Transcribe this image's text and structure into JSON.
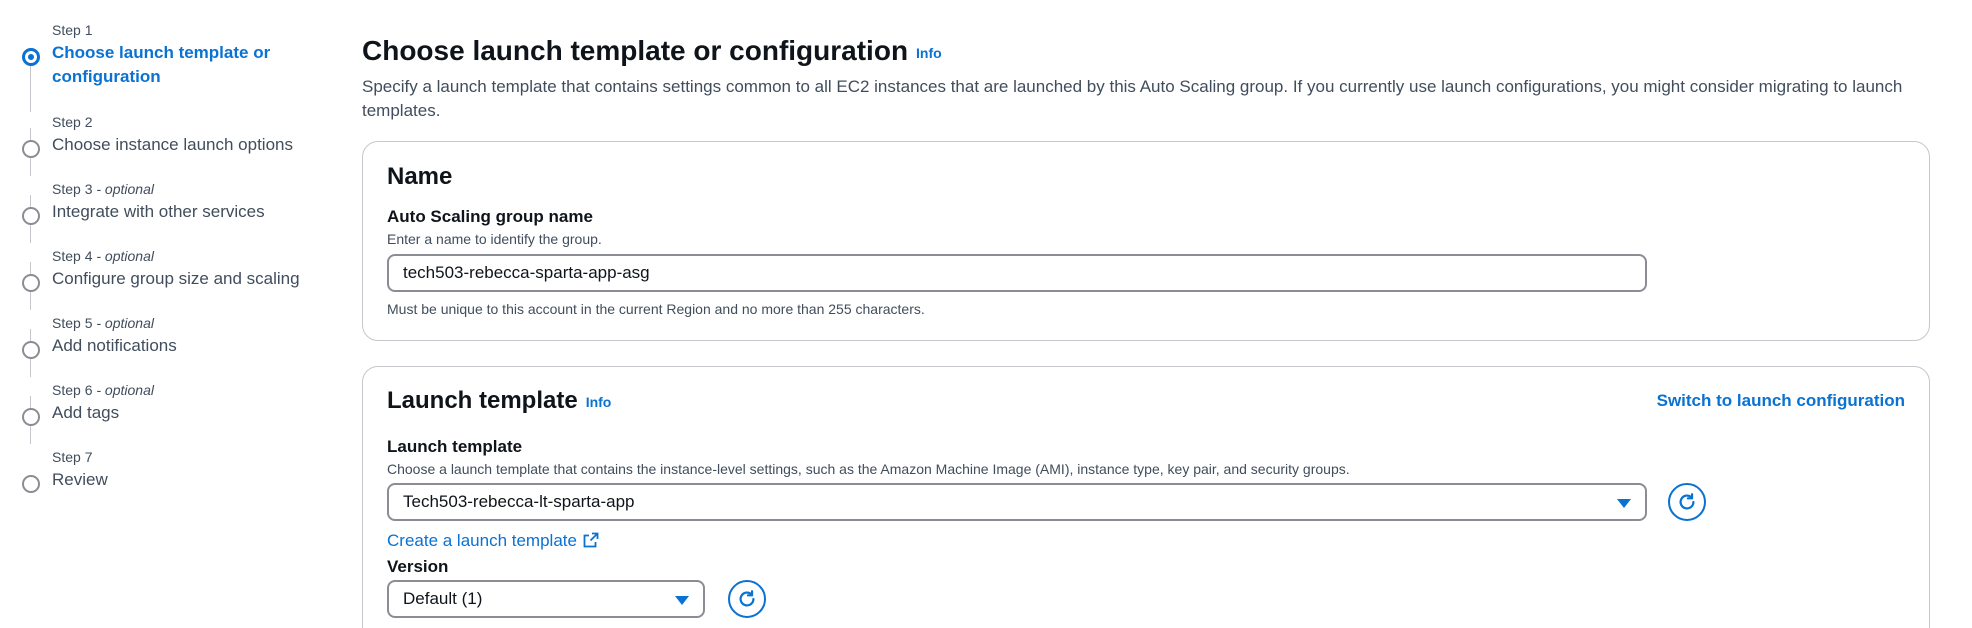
{
  "steps": [
    {
      "label": "Step 1",
      "optional": "",
      "title": "Choose launch template or configuration",
      "active": true
    },
    {
      "label": "Step 2",
      "optional": "",
      "title": "Choose instance launch options",
      "active": false
    },
    {
      "label": "Step 3",
      "optional": " - optional",
      "title": "Integrate with other services",
      "active": false
    },
    {
      "label": "Step 4",
      "optional": " - optional",
      "title": "Configure group size and scaling",
      "active": false
    },
    {
      "label": "Step 5",
      "optional": " - optional",
      "title": "Add notifications",
      "active": false
    },
    {
      "label": "Step 6",
      "optional": " - optional",
      "title": "Add tags",
      "active": false
    },
    {
      "label": "Step 7",
      "optional": "",
      "title": "Review",
      "active": false
    }
  ],
  "header": {
    "title": "Choose launch template or configuration",
    "info": "Info",
    "description": "Specify a launch template that contains settings common to all EC2 instances that are launched by this Auto Scaling group. If you currently use launch configurations, you might consider migrating to launch templates."
  },
  "name_section": {
    "title": "Name",
    "asg_label": "Auto Scaling group name",
    "asg_description": "Enter a name to identify the group.",
    "asg_value": "tech503-rebecca-sparta-app-asg",
    "asg_constraint": "Must be unique to this account in the current Region and no more than 255 characters."
  },
  "launch_template_section": {
    "title": "Launch template",
    "info": "Info",
    "switch_link": "Switch to launch configuration",
    "template_label": "Launch template",
    "template_description": "Choose a launch template that contains the instance-level settings, such as the Amazon Machine Image (AMI), instance type, key pair, and security groups.",
    "template_value": "Tech503-rebecca-lt-sparta-app",
    "create_link": "Create a launch template",
    "version_label": "Version",
    "version_value": "Default (1)"
  },
  "colors": {
    "accent": "#0972d3",
    "text": "#0f141a",
    "muted": "#414d5c",
    "border": "#c6c6cd"
  }
}
